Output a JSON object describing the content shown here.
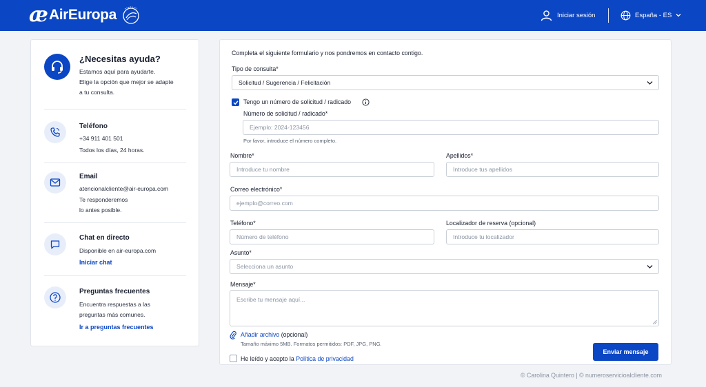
{
  "header": {
    "brand_mark": "æ",
    "brand_name": "AirEuropa",
    "login_label": "Iniciar sesión",
    "language_label": "España - ES",
    "bg_color": "#0b46c4"
  },
  "sidebar": {
    "help": {
      "title": "¿Necesitas ayuda?",
      "line1": "Estamos aquí para ayudarte.",
      "line2": "Elige la opción que mejor se adapte",
      "line3": "a tu consulta.",
      "icon": "headset-icon"
    },
    "phone": {
      "title": "Teléfono",
      "number": "+34 911 401 501",
      "hours": "Todos los días, 24 horas.",
      "icon": "phone-icon"
    },
    "email": {
      "title": "Email",
      "address": "atencionalcliente@air-europa.com",
      "line1": "Te responderemos",
      "line2": "lo antes posible.",
      "icon": "mail-icon"
    },
    "chat": {
      "title": "Chat en directo",
      "line1": "Disponible en air-europa.com",
      "link": "Iniciar chat",
      "icon": "chat-icon"
    },
    "faq": {
      "title": "Preguntas frecuentes",
      "line1": "Encuentra respuestas a las",
      "line2": "preguntas más comunes.",
      "link": "Ir a preguntas frecuentes",
      "icon": "question-icon"
    }
  },
  "form": {
    "intro": "Completa el siguiente formulario y nos pondremos en contacto contigo.",
    "tipo_label": "Tipo de consulta*",
    "tipo_value": "Solicitud / Sugerencia / Felicitación",
    "has_number_label": "Tengo un número de solicitud / radicado",
    "has_number_checked": true,
    "number_label": "Número de solicitud / radicado*",
    "number_placeholder": "Ejemplo: 2024-123456",
    "number_hint": "Por favor, introduce el número completo.",
    "nombre_label": "Nombre*",
    "nombre_placeholder": "Introduce tu nombre",
    "apellidos_label": "Apellidos*",
    "apellidos_placeholder": "Introduce tus apellidos",
    "email_label": "Correo electrónico*",
    "email_placeholder": "ejemplo@correo.com",
    "telefono_label": "Teléfono*",
    "telefono_placeholder": "Número de teléfono",
    "localizador_label": "Localizador de reserva (opcional)",
    "localizador_placeholder": "Introduce tu localizador",
    "asunto_label": "Asunto*",
    "asunto_placeholder": "Selecciona un asunto",
    "mensaje_label": "Mensaje*",
    "mensaje_placeholder": "Escribe tu mensaje aquí...",
    "attach_link": "Añadir archivo",
    "attach_optional": "(opcional)",
    "attach_hint": "Tamaño máximo 5MB. Formatos permitidos: PDF, JPG, PNG.",
    "privacy_prefix": "He leído y acepto la",
    "privacy_link": "Política de privacidad",
    "privacy_checked": false,
    "submit_label": "Enviar mensaje"
  },
  "footer": {
    "text": "© Carolina Quintero | © numeroservicioalcliente.com"
  }
}
